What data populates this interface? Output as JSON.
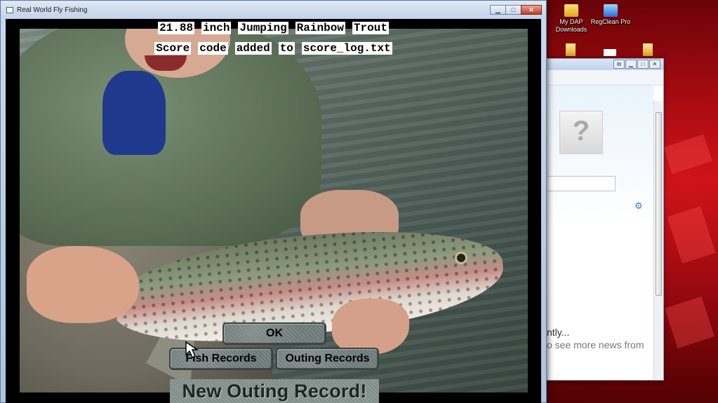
{
  "window": {
    "title": "Real World Fly Fishing",
    "controls": {
      "minimize": "▁",
      "maximize": "□",
      "close": "✕"
    }
  },
  "game": {
    "catch_message_words": [
      "21.88",
      "inch",
      "Jumping",
      "Rainbow",
      "Trout"
    ],
    "score_message_words": [
      "Score",
      "code",
      "added",
      "to",
      "score_log.txt"
    ],
    "ok_button": "OK",
    "fish_records_button": "Fish Records",
    "outing_records_button": "Outing Records",
    "record_banner": "New Outing Record!"
  },
  "desktop": {
    "icons": [
      {
        "label": "My DAP Downloads",
        "icon": "folder-download-icon"
      },
      {
        "label": "RegClean Pro",
        "icon": "regclean-icon"
      }
    ]
  },
  "background_window": {
    "controls": {
      "restore": "⧉",
      "minimize": "▁",
      "maximize": "□",
      "close": "✕"
    },
    "avatar_glyph": "?",
    "text_line1": "ntly...",
    "text_line2": "o see more news from"
  },
  "colors": {
    "overlay_text_bg": "#ffffff",
    "button_stone": "#7c8886",
    "titlebar": "#c1d3ea",
    "desktop_red": "#d0141a"
  }
}
